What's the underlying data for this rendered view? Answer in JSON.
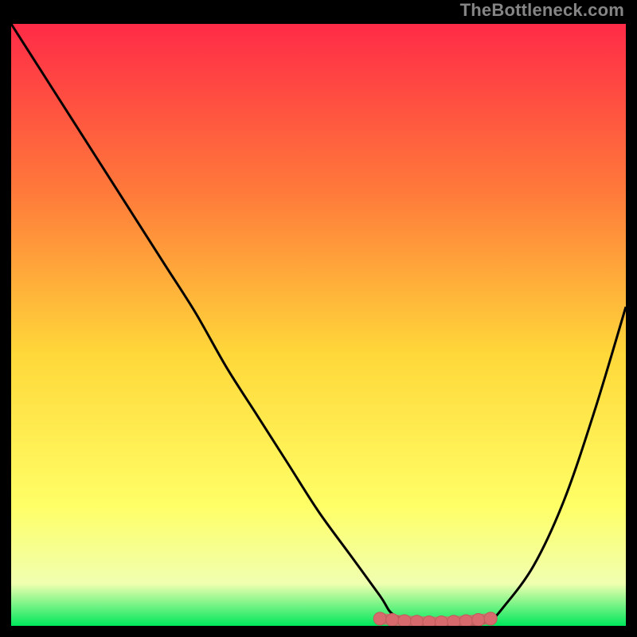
{
  "watermark": "TheBottleneck.com",
  "colors": {
    "gradient_top": "#ff2b47",
    "gradient_mid_upper": "#ff7a3a",
    "gradient_mid": "#ffd83a",
    "gradient_mid_lower": "#ffff66",
    "gradient_lower": "#f0ffb0",
    "gradient_bottom": "#00e85c",
    "curve": "#000000",
    "marker_fill": "#d66a6c",
    "marker_stroke": "#c25a5c"
  },
  "chart_data": {
    "type": "line",
    "title": "",
    "xlabel": "",
    "ylabel": "",
    "xlim": [
      0,
      100
    ],
    "ylim": [
      0,
      100
    ],
    "series": [
      {
        "name": "bottleneck-curve",
        "x": [
          0,
          5,
          10,
          15,
          20,
          25,
          30,
          35,
          40,
          45,
          50,
          55,
          60,
          62,
          65,
          70,
          75,
          78,
          80,
          85,
          90,
          95,
          100
        ],
        "y": [
          100,
          92,
          84,
          76,
          68,
          60,
          52,
          43,
          35,
          27,
          19,
          12,
          5,
          2,
          1,
          0,
          0,
          1,
          3,
          10,
          21,
          36,
          53
        ]
      }
    ],
    "markers": {
      "name": "highlighted-range",
      "x": [
        60,
        62,
        64,
        66,
        68,
        70,
        72,
        74,
        76,
        78
      ],
      "y": [
        1.2,
        1.0,
        0.8,
        0.7,
        0.6,
        0.6,
        0.7,
        0.8,
        1.0,
        1.2
      ]
    }
  }
}
